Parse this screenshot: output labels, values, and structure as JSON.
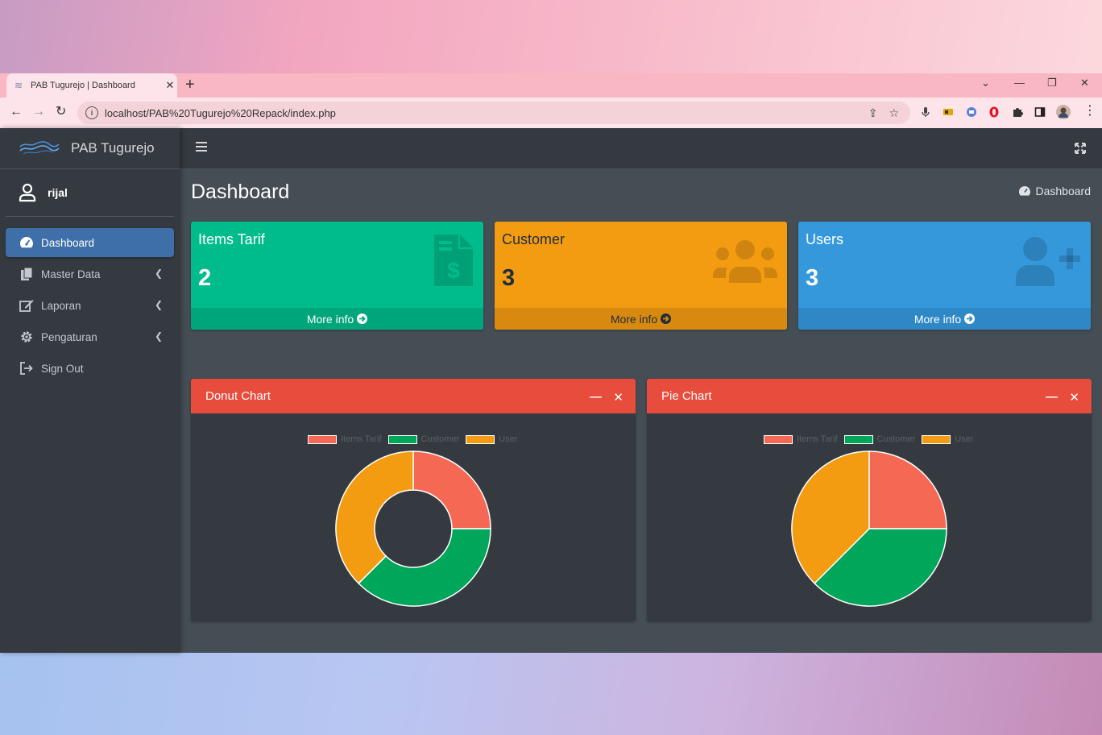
{
  "browser": {
    "tab_title": "PAB Tugurejo | Dashboard",
    "url": "localhost/PAB%20Tugurejo%20Repack/index.php"
  },
  "app": {
    "brand": "PAB Tugurejo",
    "user_name": "rijal",
    "menu": [
      {
        "label": "Dashboard",
        "icon": "tachometer-icon",
        "active": true
      },
      {
        "label": "Master Data",
        "icon": "copy-icon",
        "chevron": true
      },
      {
        "label": "Laporan",
        "icon": "edit-icon",
        "chevron": true
      },
      {
        "label": "Pengaturan",
        "icon": "gear-icon",
        "chevron": true
      },
      {
        "label": "Sign Out",
        "icon": "sign-out-icon"
      }
    ],
    "page_title": "Dashboard",
    "breadcrumb": "Dashboard"
  },
  "stats": [
    {
      "label": "Items Tarif",
      "value": "2",
      "more": "More info",
      "color": "#00bc8c",
      "footer_color": "#00a67b",
      "icon": "file-invoice-dollar-icon"
    },
    {
      "label": "Customer",
      "value": "3",
      "more": "More info",
      "color": "#f39c12",
      "footer_color": "#d8890f",
      "icon": "users-icon"
    },
    {
      "label": "Users",
      "value": "3",
      "more": "More info",
      "color": "#3498db",
      "footer_color": "#2f88c6",
      "icon": "user-plus-icon"
    }
  ],
  "charts": {
    "donut_title": "Donut Chart",
    "pie_title": "Pie Chart"
  },
  "chart_data": [
    {
      "type": "pie",
      "variant": "donut",
      "title": "Donut Chart",
      "categories": [
        "Items Tarif",
        "Customer",
        "User"
      ],
      "values": [
        2,
        3,
        3
      ],
      "colors": [
        "#f56954",
        "#00a65a",
        "#f39c12"
      ],
      "legend": "top"
    },
    {
      "type": "pie",
      "title": "Pie Chart",
      "categories": [
        "Items Tarif",
        "Customer",
        "User"
      ],
      "values": [
        2,
        3,
        3
      ],
      "colors": [
        "#f56954",
        "#00a65a",
        "#f39c12"
      ],
      "legend": "top"
    }
  ]
}
